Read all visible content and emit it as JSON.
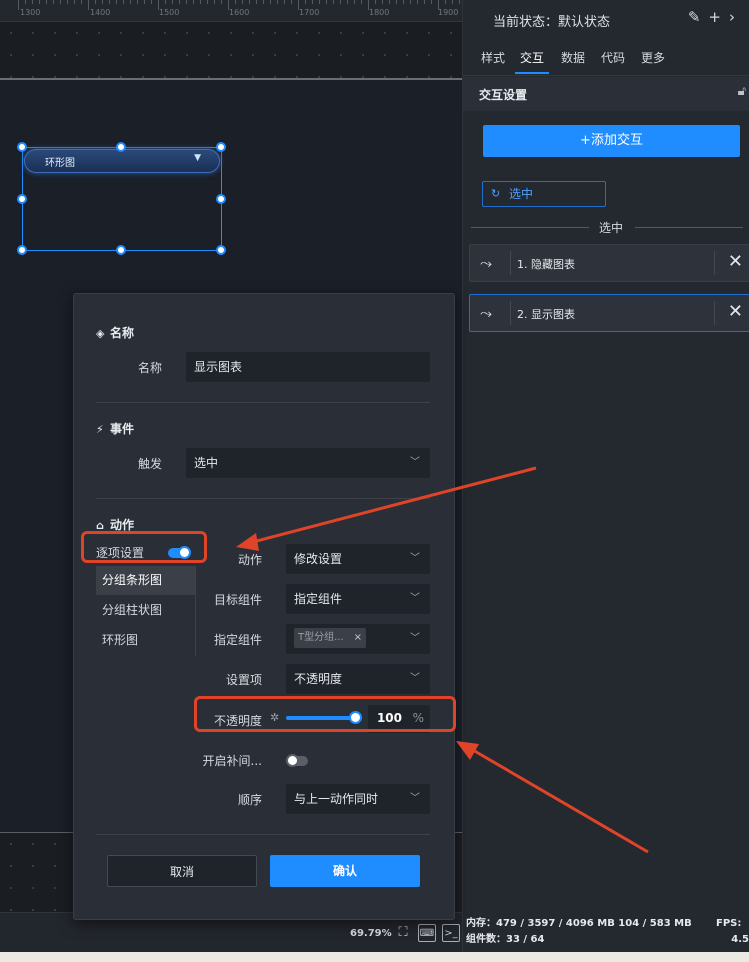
{
  "ruler": {
    "labels": [
      "1300",
      "1400",
      "1500",
      "1600",
      "1700",
      "1800",
      "1900"
    ]
  },
  "canvas": {
    "component_label": "环形图",
    "component_chevron": "▼"
  },
  "bottom_bar": {
    "zoom": "69.79%"
  },
  "right_panel": {
    "header": "当前状态：默认状态",
    "tabs": [
      "样式",
      "交互",
      "数据",
      "代码",
      "更多"
    ],
    "section_title": "交互设置",
    "add_button": "+添加交互",
    "selected_tag": "选中",
    "divider_label": "选中",
    "actions": [
      {
        "label": "1. 隐藏图表"
      },
      {
        "label": "2. 显示图表"
      }
    ],
    "status": {
      "memory": "内存：479 / 3597 / 4096 MB  104 / 583 MB",
      "components": "组件数：33 / 64",
      "fps": "FPS:",
      "fps_value": "4.5"
    }
  },
  "dialog": {
    "name_section": "名称",
    "name_label": "名称",
    "name_value": "显示图表",
    "event_section": "事件",
    "trigger_label": "触发",
    "trigger_value": "选中",
    "action_section": "动作",
    "per_item_label": "逐项设置",
    "items": [
      "分组条形图",
      "分组柱状图",
      "环形图"
    ],
    "action_label": "动作",
    "action_value": "修改设置",
    "target_label": "目标组件",
    "target_value": "指定组件",
    "specified_label": "指定组件",
    "specified_chip": "T型分组...",
    "setting_label": "设置项",
    "setting_value": "不透明度",
    "opacity_label": "不透明度",
    "opacity_value": "100",
    "opacity_unit": "%",
    "opacity_fraction": 1.0,
    "tween_label": "开启补间...",
    "order_label": "顺序",
    "order_value": "与上一动作同时",
    "cancel": "取消",
    "confirm": "确认"
  },
  "colors": {
    "accent": "#1f8cff",
    "annotation": "#e04428"
  }
}
